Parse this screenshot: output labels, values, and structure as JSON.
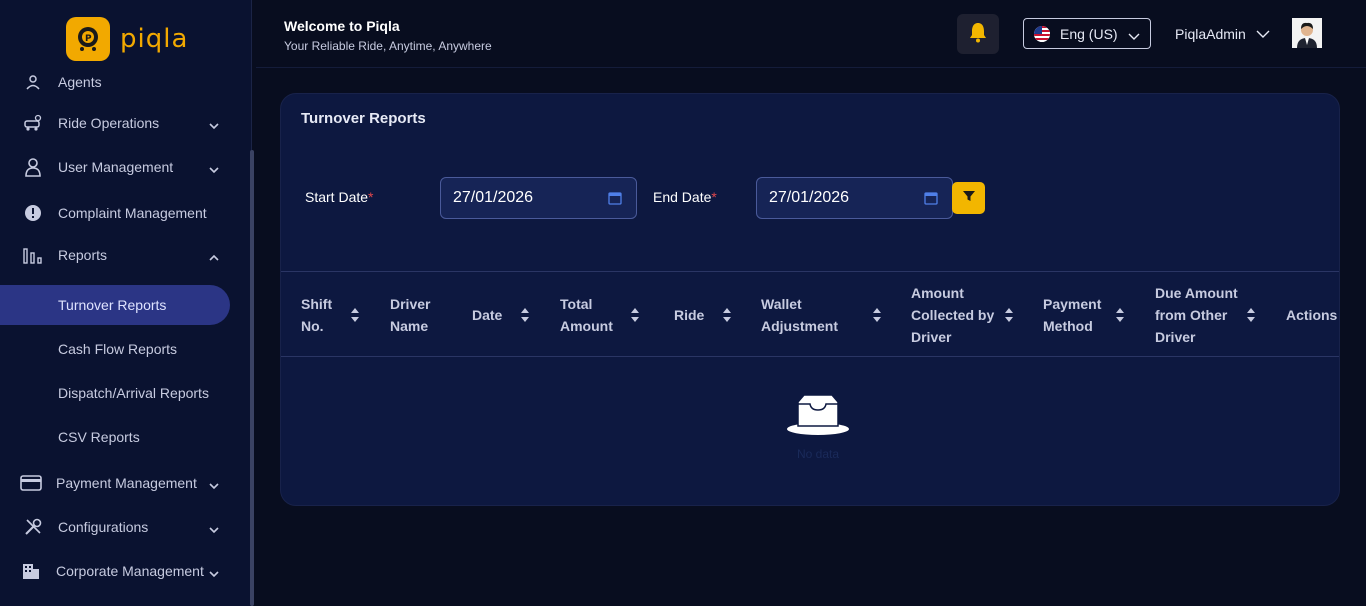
{
  "brand": {
    "name": "piqla",
    "color": "#f2a900"
  },
  "sidebar": {
    "items": [
      {
        "label": "Agents",
        "icon": "agents-icon"
      },
      {
        "label": "Ride Operations",
        "icon": "car-gear-icon"
      },
      {
        "label": "User Management",
        "icon": "user-icon"
      },
      {
        "label": "Complaint Management",
        "icon": "alert-circle-icon"
      },
      {
        "label": "Reports",
        "icon": "bar-chart-icon"
      },
      {
        "label": "Payment Management",
        "icon": "credit-card-icon"
      },
      {
        "label": "Configurations",
        "icon": "tools-icon"
      },
      {
        "label": "Corporate Management",
        "icon": "building-icon"
      }
    ],
    "reports_sub": [
      {
        "label": "Turnover Reports",
        "active": true
      },
      {
        "label": "Cash Flow Reports"
      },
      {
        "label": "Dispatch/Arrival Reports"
      },
      {
        "label": "CSV Reports"
      }
    ]
  },
  "header": {
    "title": "Welcome to Piqla",
    "subtitle": "Your Reliable Ride, Anytime, Anywhere",
    "language": "Eng (US)",
    "user": "PiqlaAdmin"
  },
  "card": {
    "title": "Turnover Reports",
    "start_label": "Start Date",
    "end_label": "End Date",
    "required_mark": "*",
    "start_value": "27/01/2026",
    "end_value": "27/01/2026"
  },
  "table": {
    "columns": [
      {
        "label": "Shift No.",
        "sortable": true
      },
      {
        "label": "Driver Name",
        "sortable": false
      },
      {
        "label": "Date",
        "sortable": true
      },
      {
        "label": "Total Amount",
        "sortable": true
      },
      {
        "label": "Ride",
        "sortable": true
      },
      {
        "label": "Wallet Adjustment",
        "sortable": true
      },
      {
        "label": "Amount Collected by Driver",
        "sortable": true
      },
      {
        "label": "Payment Method",
        "sortable": true
      },
      {
        "label": "Due Amount from Other Driver",
        "sortable": true
      },
      {
        "label": "Actions",
        "sortable": false
      }
    ],
    "empty_text": "No data"
  },
  "colors": {
    "sidebar_bg": "#0a1230",
    "page_bg": "#080d1f",
    "card_bg": "#0d1840",
    "active_item": "#2b3585",
    "accent": "#f2b600"
  }
}
